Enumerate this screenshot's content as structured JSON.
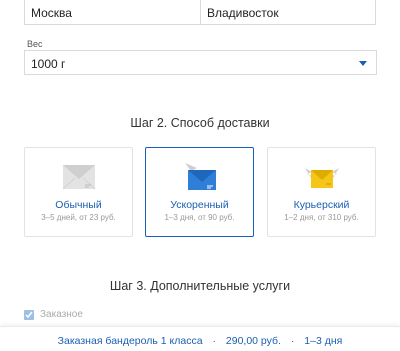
{
  "route": {
    "from": "Москва",
    "to": "Владивосток"
  },
  "weight": {
    "label": "Вес",
    "value": "1000 г"
  },
  "step2": {
    "title": "Шаг 2. Способ доставки",
    "options": [
      {
        "name": "Обычный",
        "meta": "3–5 дней, от 23 руб.",
        "icon": "envelope-icon",
        "selected": false
      },
      {
        "name": "Ускоренный",
        "meta": "1–3 дня, от 90 руб.",
        "icon": "airplane-envelope-icon",
        "selected": true
      },
      {
        "name": "Курьерский",
        "meta": "1–2 дня, от 310 руб.",
        "icon": "winged-envelope-icon",
        "selected": false
      }
    ]
  },
  "step3": {
    "title": "Шаг 3. Дополнительные услуги",
    "registered_label": "Заказное",
    "registered_checked": true
  },
  "summary": {
    "product": "Заказная бандероль 1 класса",
    "price": "290,00 руб.",
    "term": "1–3 дня",
    "separator": "·"
  },
  "colors": {
    "accent": "#1a5fb4",
    "envelope_gray": "#dcdcdc",
    "envelope_blue": "#2f7fd9",
    "envelope_yellow": "#f5c518"
  }
}
